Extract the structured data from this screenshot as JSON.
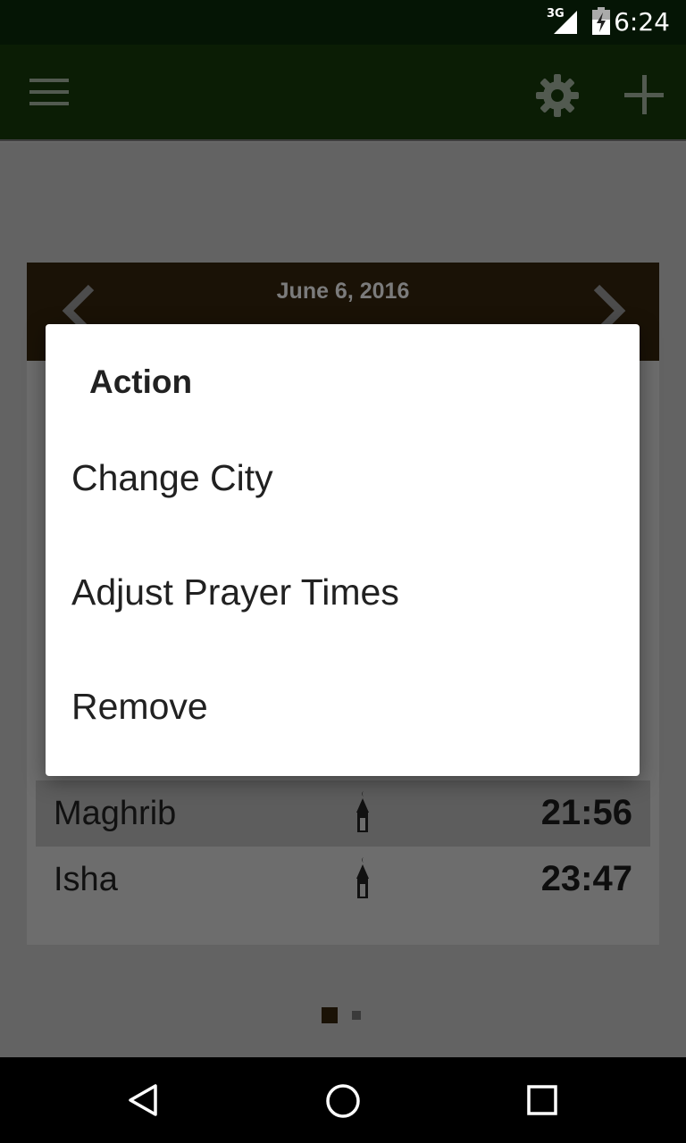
{
  "status_bar": {
    "network": "3G",
    "clock": "6:24",
    "icons": [
      "signal-icon",
      "battery-icon"
    ]
  },
  "app_bar": {
    "icons": [
      "menu-icon",
      "settings-icon",
      "add-icon"
    ]
  },
  "card": {
    "date": "June 6, 2016",
    "prayers": [
      {
        "name": "Maghrib",
        "time": "21:56",
        "icon": "minaret-icon"
      },
      {
        "name": "Isha",
        "time": "23:47",
        "icon": "minaret-icon"
      }
    ]
  },
  "pager": {
    "count": 2,
    "active": 1
  },
  "dialog": {
    "title": "Action",
    "items": [
      "Change City",
      "Adjust Prayer Times",
      "Remove"
    ]
  },
  "nav_bar": {
    "icons": [
      "back-icon",
      "home-icon",
      "recent-apps-icon"
    ]
  },
  "colors": {
    "app_bar": "#0b1d05",
    "card_header": "#1a1206",
    "scrim": "#636363",
    "dialog": "#ffffff"
  }
}
